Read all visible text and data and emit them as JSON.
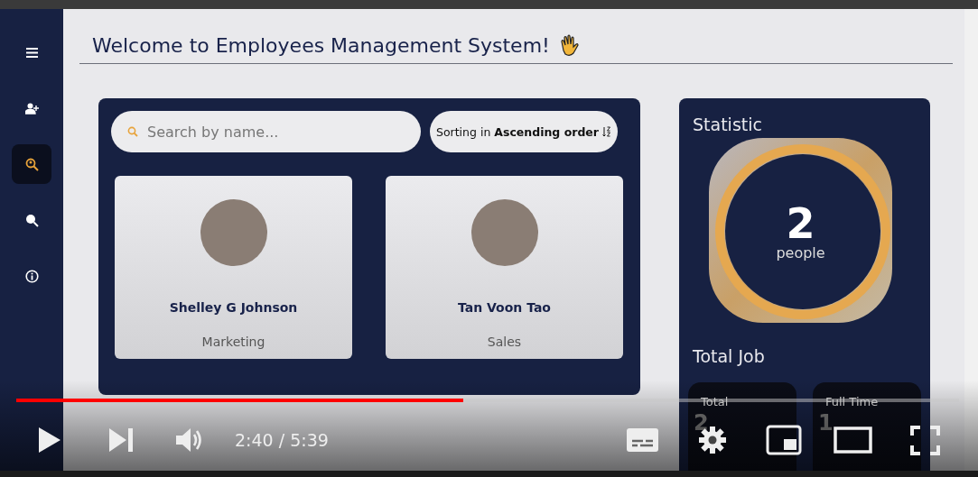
{
  "sidebar": {
    "items": [
      {
        "kind": "menu",
        "selected": false
      },
      {
        "kind": "add-person",
        "selected": false
      },
      {
        "kind": "search-person",
        "selected": true
      },
      {
        "kind": "search",
        "selected": false
      },
      {
        "kind": "info",
        "selected": false
      }
    ]
  },
  "title": "Welcome to Employees Management System!",
  "search": {
    "placeholder": "Search by name..."
  },
  "sort": {
    "label": "Sorting in **Ascending order**"
  },
  "employees": [
    {
      "name": "Shelley G Johnson",
      "department": "Marketing"
    },
    {
      "name": "Tan Voon Tao",
      "department": "Sales"
    }
  ],
  "statistic": {
    "title": "Statistic",
    "count": "2",
    "unit": "people"
  },
  "total_job": {
    "title": "Total Job",
    "cards": [
      {
        "label": "Total",
        "value": "2"
      },
      {
        "label": "Full Time",
        "value": "1"
      }
    ]
  },
  "player": {
    "progress": {
      "level": 0.474
    },
    "time": "2:40 / 5:39"
  }
}
